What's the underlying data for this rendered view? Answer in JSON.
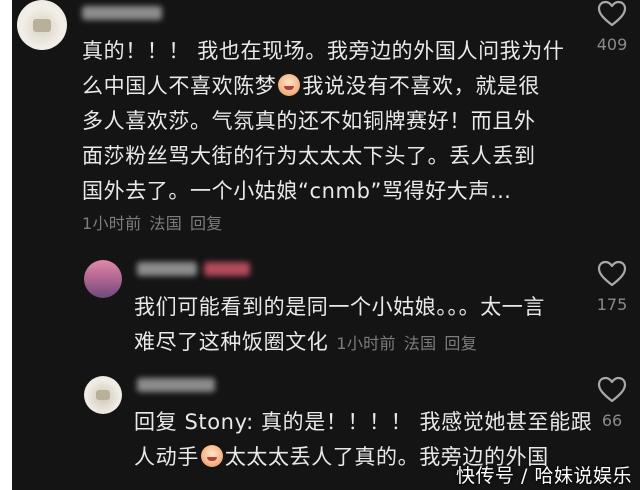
{
  "comments": [
    {
      "text_lines": [
        "真的！！！ 我也在现场。我旁边的外国人问我为什",
        [
          "么中国人不喜欢陈梦",
          "我说没有不喜欢，就是很"
        ],
        "多人喜欢莎。气氛真的还不如铜牌赛好！而且外",
        "面莎粉丝骂大街的行为太太太下头了。丢人丢到",
        "国外去了。一个小姑娘“cnmb”骂得好大声…"
      ],
      "time": "1小时前",
      "location": "法国",
      "reply_label": "回复",
      "likes": "409"
    },
    {
      "text_lines": [
        "我们可能看到的是同一个小姑娘。。。太一言",
        "难尽了这种饭圈文化"
      ],
      "time": "1小时前",
      "location": "法国",
      "reply_label": "回复",
      "likes": "175"
    },
    {
      "text_lines": [
        "回复 Stony: 真的是！！！！ 我感觉她甚至能跟",
        [
          "人动手",
          "太太太丢人了真的。我旁边的外国"
        ]
      ],
      "likes": "66"
    }
  ],
  "icons": {
    "like": "heart-outline-icon",
    "emoji_1": "crying-face-emoji",
    "emoji_2": "crying-face-emoji"
  },
  "watermark": "快传号 / 哈妹说娱乐",
  "colors": {
    "background": "#141414",
    "text": "#e9e9e9",
    "meta": "#7d7d7d"
  }
}
